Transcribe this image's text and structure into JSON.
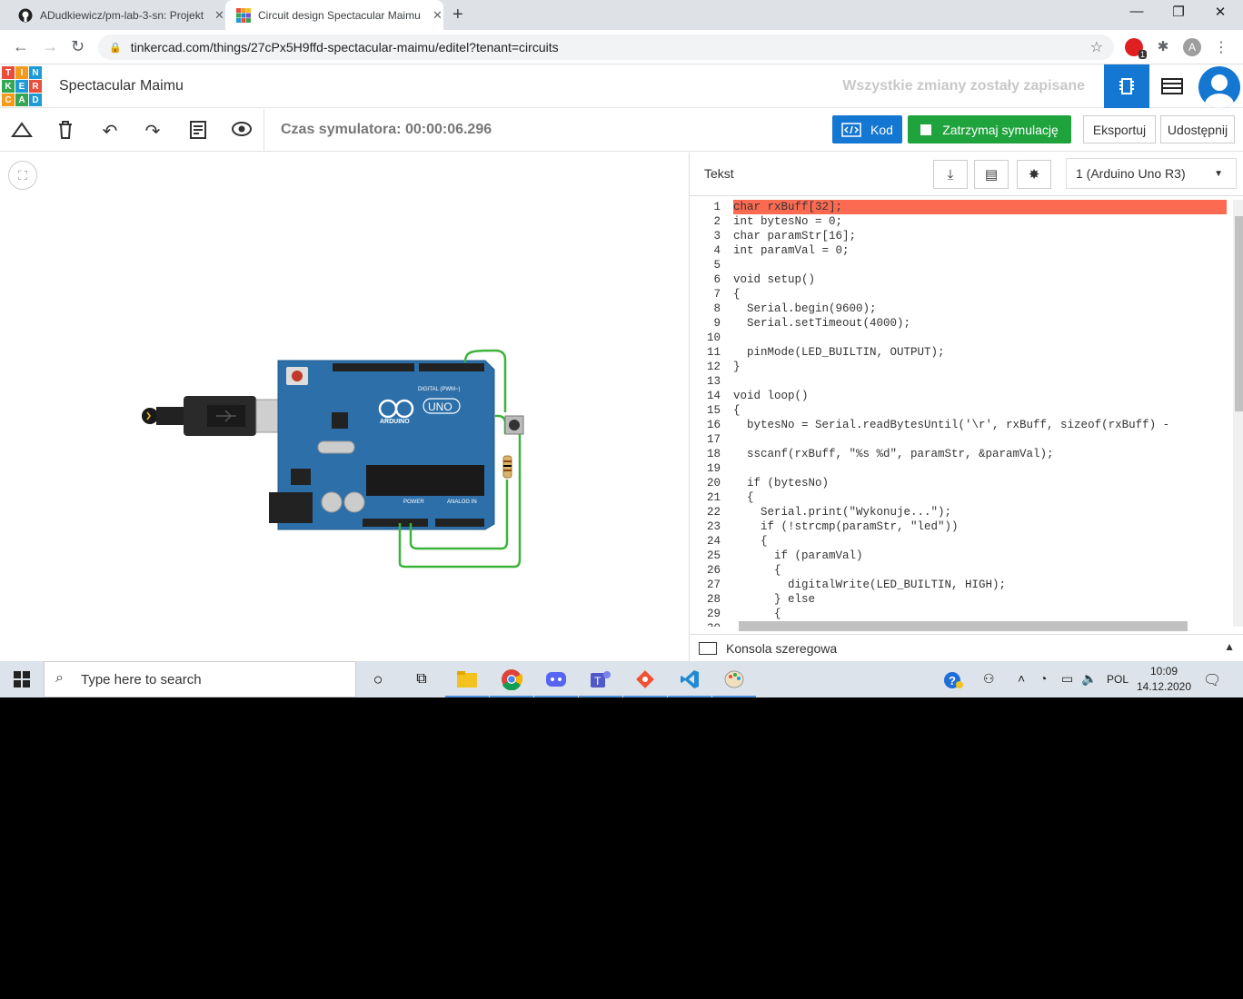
{
  "browser": {
    "tabs": [
      {
        "title": "ADudkiewicz/pm-lab-3-sn: Projekt",
        "icon": "github-icon"
      },
      {
        "title": "Circuit design Spectacular Maimu",
        "icon": "tinkercad-icon"
      }
    ],
    "url": "tinkercad.com/things/27cPx5H9ffd-spectacular-maimu/editel?tenant=circuits",
    "profile_letter": "A",
    "ext_badge": "1"
  },
  "header": {
    "logo_letters": [
      "T",
      "I",
      "N",
      "K",
      "E",
      "R",
      "C",
      "A",
      "D"
    ],
    "project_title": "Spectacular Maimu",
    "saved_status": "Wszystkie zmiany zostały zapisane"
  },
  "toolbar": {
    "sim_time": "Czas symulatora: 00:00:06.296",
    "code_label": "Kod",
    "stop_label": "Zatrzymaj symulację",
    "export_label": "Eksportuj",
    "share_label": "Udostępnij"
  },
  "code_panel": {
    "mode": "Tekst",
    "device": "1 (Arduino Uno R3)",
    "console_label": "Konsola szeregowa",
    "lines": [
      "char rxBuff[32];",
      "int bytesNo = 0;",
      "char paramStr[16];",
      "int paramVal = 0;",
      "",
      "void setup()",
      "{",
      "  Serial.begin(9600);",
      "  Serial.setTimeout(4000);",
      "",
      "  pinMode(LED_BUILTIN, OUTPUT);",
      "}",
      "",
      "void loop()",
      "{",
      "  bytesNo = Serial.readBytesUntil('\\r', rxBuff, sizeof(rxBuff) -",
      "",
      "  sscanf(rxBuff, \"%s %d\", paramStr, &paramVal);",
      "",
      "  if (bytesNo)",
      "  {",
      "    Serial.print(\"Wykonuje...\");",
      "    if (!strcmp(paramStr, \"led\"))",
      "    {",
      "      if (paramVal)",
      "      {",
      "        digitalWrite(LED_BUILTIN, HIGH);",
      "      } else",
      "      {",
      ""
    ]
  },
  "arduino": {
    "brand": "ARDUINO",
    "model": "UNO",
    "digital_label": "DIGITAL (PWM~)",
    "power_label": "POWER",
    "analog_label": "ANALOG IN"
  },
  "taskbar": {
    "search_placeholder": "Type here to search",
    "language": "POL",
    "time": "10:09",
    "date": "14.12.2020"
  },
  "colors": {
    "tinkercad_blue": "#1477d1",
    "sim_green": "#1fa33d",
    "error_line": "#fd6a52",
    "board_blue": "#2d6fa9",
    "wire_green": "#3cb43c"
  }
}
